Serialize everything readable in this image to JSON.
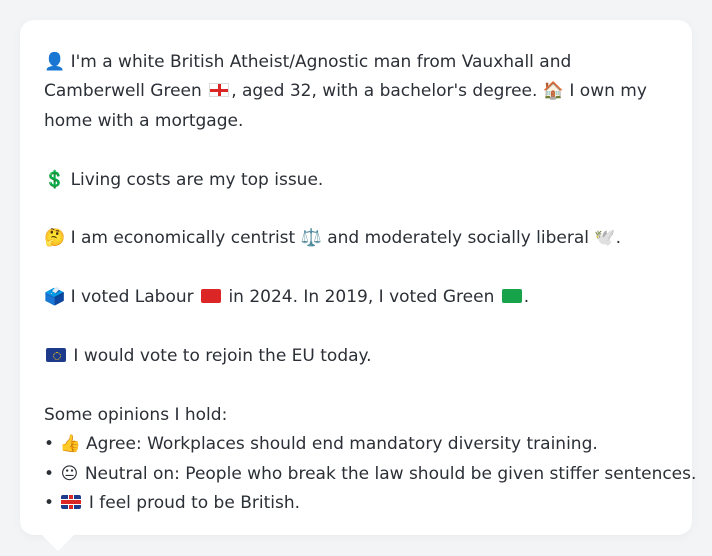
{
  "profile": {
    "intro": {
      "icon": "person-silhouette-icon",
      "text_part_1": "I'm a white British Atheist/Agnostic man from Vauxhall and Camberwell Green",
      "flag_icon": "england-flag-icon",
      "text_part_2": ", aged 32, with a bachelor's degree.",
      "home_icon": "house-icon",
      "text_part_3": "I own my home with a mortgage."
    },
    "issue": {
      "icon": "dollar-icon",
      "text": "Living costs are my top issue."
    },
    "stance": {
      "icon": "thinking-face-icon",
      "text_part_1": "I am economically centrist",
      "scale_icon": "balance-scale-icon",
      "text_part_2": "and moderately socially liberal",
      "dove_icon": "dove-icon",
      "text_part_3": "."
    },
    "votes": {
      "icon": "ballot-box-icon",
      "text_part_1": "I voted Labour",
      "labour_icon": "red-square-icon",
      "text_part_2": "in 2024. In 2019, I voted Green",
      "green_icon": "green-square-icon",
      "text_part_3": "."
    },
    "eu": {
      "icon": "eu-flag-icon",
      "text": "I would vote to rejoin the EU today."
    },
    "opinions": {
      "title": "Some opinions I hold:",
      "items": [
        {
          "bullet": "•",
          "icon": "thumbs-up-icon",
          "text": "Agree: Workplaces should end mandatory diversity training."
        },
        {
          "bullet": "•",
          "icon": "neutral-face-icon",
          "text": "Neutral on: People who break the law should be given stiffer sentences."
        },
        {
          "bullet": "•",
          "icon": "uk-flag-icon",
          "text": "I feel proud to be British."
        }
      ]
    }
  },
  "colors": {
    "page_background": "#f3f4f6",
    "bubble_background": "#ffffff",
    "text": "#2b2f36",
    "labour_red": "#dc2626",
    "green_party": "#16a34a"
  }
}
